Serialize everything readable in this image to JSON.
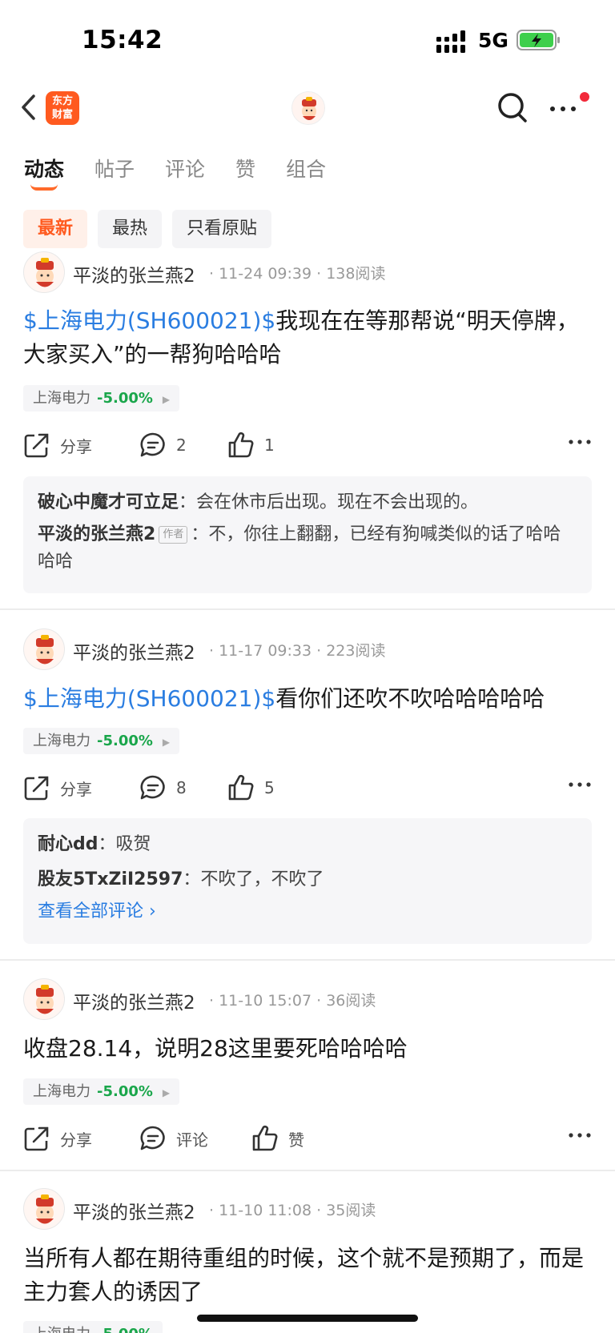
{
  "status_bar": {
    "time": "15:42",
    "network": "5G"
  },
  "header": {
    "logo_text_line1": "东方",
    "logo_text_line2": "财富"
  },
  "tabs": [
    "动态",
    "帖子",
    "评论",
    "赞",
    "组合"
  ],
  "filters": [
    "最新",
    "最热",
    "只看原贴"
  ],
  "labels": {
    "share": "分享",
    "comment": "评论",
    "like": "赞",
    "author_tag": "作者",
    "view_all": "查看全部评论 ›"
  },
  "posts": [
    {
      "author": "平淡的张兰燕2",
      "meta": "· 11-24 09:39 · 138阅读",
      "link": "$上海电力(SH600021)$",
      "text": "我现在在等那帮说“明天停牌，大家买入”的一帮狗哈哈哈",
      "stock": "上海电力",
      "change": "-5.00%",
      "comments_count": "2",
      "likes": "1",
      "comments": [
        {
          "author": "破心中魔才可立足",
          "text": "会在休市后出现。现在不会出现的。"
        },
        {
          "author": "平淡的张兰燕2",
          "text": "不，你往上翻翻，已经有狗喊类似的话了哈哈哈哈"
        }
      ]
    },
    {
      "author": "平淡的张兰燕2",
      "meta": "· 11-17 09:33 · 223阅读",
      "link": "$上海电力(SH600021)$",
      "text": "看你们还吹不吹哈哈哈哈哈",
      "stock": "上海电力",
      "change": "-5.00%",
      "comments_count": "8",
      "likes": "5",
      "comments": [
        {
          "author": "耐心dd",
          "text": "吸贺"
        },
        {
          "author": "股友5TxZiI2597",
          "text": "不吹了，不吹了"
        }
      ]
    },
    {
      "author": "平淡的张兰燕2",
      "meta": "· 11-10 15:07 · 36阅读",
      "text": "收盘28.14，说明28这里要死哈哈哈哈",
      "stock": "上海电力",
      "change": "-5.00%"
    },
    {
      "author": "平淡的张兰燕2",
      "meta": "· 11-10 11:08 · 35阅读",
      "text": "当所有人都在期待重组的时候，这个就不是预期了，而是主力套人的诱因了",
      "stock": "上海电力",
      "change": "-5.00%"
    }
  ],
  "colors": {
    "accent": "#ff5a1f",
    "link": "#2a7de1",
    "down": "#1aa64b"
  }
}
